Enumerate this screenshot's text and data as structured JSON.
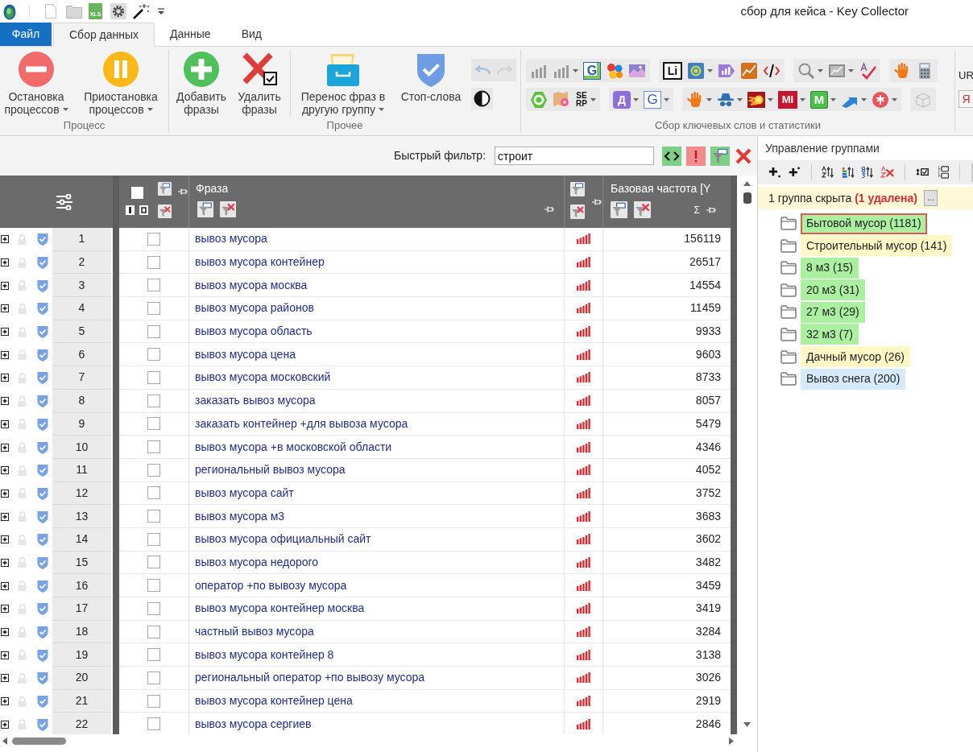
{
  "title_bar": {
    "title": "сбор для кейса - Key Collector",
    "xls_icon_text": "XLS"
  },
  "ribbon": {
    "tabs": [
      {
        "label": "Файл",
        "kind": "file",
        "selected": false
      },
      {
        "label": "Сбор данных",
        "kind": "tab",
        "selected": true
      },
      {
        "label": "Данные",
        "kind": "tab",
        "selected": false
      },
      {
        "label": "Вид",
        "kind": "tab",
        "selected": false
      }
    ],
    "groups": [
      {
        "label": "Процесс",
        "history_tools": false,
        "sections": [
          [
            {
              "kind": "stop",
              "lines": [
                "Остановка",
                "процессов"
              ],
              "dropdown": true
            },
            {
              "kind": "pause",
              "lines": [
                "Приостановка",
                "процессов"
              ],
              "dropdown": true
            }
          ]
        ]
      },
      {
        "label": "Прочее",
        "history_tools": true,
        "sections": [
          [
            {
              "kind": "add",
              "lines": [
                "Добавить",
                "фразы"
              ],
              "dropdown": false
            },
            {
              "kind": "delete",
              "lines": [
                "Удалить",
                "фразы"
              ],
              "dropdown": false
            }
          ],
          [
            {
              "kind": "move",
              "lines": [
                "Перенос фраз в",
                "другую группу"
              ],
              "dropdown": true
            },
            {
              "kind": "stop_words",
              "lines": [
                "Стоп-слова"
              ],
              "dropdown": false
            }
          ]
        ]
      }
    ],
    "keyword_tools": {
      "label": "Сбор ключевых слов и статистики",
      "rows": [
        [
          {
            "items": [
              {
                "kind": "bars",
                "dropdown": false
              },
              {
                "kind": "bars",
                "dropdown": true
              },
              {
                "kind": "g_doc",
                "text": "G",
                "dropdown": false
              },
              {
                "kind": "dots",
                "dropdown": false
              },
              {
                "kind": "landscape",
                "dropdown": false
              }
            ]
          },
          {
            "items": [
              {
                "kind": "li",
                "text": "Li",
                "dropdown": false
              },
              {
                "kind": "globe",
                "dropdown": true
              },
              {
                "kind": "chart_tile",
                "dropdown": false
              },
              {
                "kind": "line_chart_tile",
                "dropdown": false
              },
              {
                "kind": "code",
                "dropdown": false
              }
            ]
          },
          {
            "items": [
              {
                "kind": "search",
                "dropdown": true
              },
              {
                "kind": "image_chart",
                "dropdown": true
              },
              {
                "kind": "spellcheck",
                "dropdown": false
              }
            ]
          },
          {
            "items": [
              {
                "kind": "hand",
                "dropdown": false
              },
              {
                "kind": "calculator",
                "dropdown": false
              }
            ]
          }
        ],
        [
          {
            "items": [
              {
                "kind": "ring",
                "dropdown": false
              },
              {
                "kind": "map_pin",
                "dropdown": false
              },
              {
                "kind": "serp",
                "text": "SERP",
                "dropdown": true
              }
            ]
          },
          {
            "items": [
              {
                "kind": "d_logo",
                "text": "Д",
                "dropdown": true
              },
              {
                "kind": "g_logo",
                "text": "G",
                "dropdown": true
              }
            ]
          },
          {
            "items": [
              {
                "kind": "hand",
                "dropdown": true
              },
              {
                "kind": "spy",
                "dropdown": true
              },
              {
                "kind": "fireball",
                "dropdown": true
              },
              {
                "kind": "mi_logo",
                "text": "MI",
                "dropdown": true
              },
              {
                "kind": "m_logo",
                "text": "M",
                "dropdown": true
              },
              {
                "kind": "arrow",
                "dropdown": true
              },
              {
                "kind": "circle_logo",
                "dropdown": true
              }
            ]
          },
          {
            "items": [
              {
                "kind": "box",
                "dropdown": false
              }
            ]
          }
        ]
      ]
    },
    "cut_group": {
      "label": "UR",
      "icon_text": "Я"
    }
  },
  "filter": {
    "label": "Быстрый фильтр:",
    "value": "строит"
  },
  "table": {
    "select_all_checked": false,
    "columns": {
      "phrase": "Фраза",
      "frequency": "Базовая частота [Y",
      "sum_sign": "Σ"
    },
    "rows": [
      {
        "number": "1",
        "checked": false,
        "phrase": "вывоз мусора",
        "frequency": "156119"
      },
      {
        "number": "2",
        "checked": false,
        "phrase": "вывоз мусора контейнер",
        "frequency": "26517"
      },
      {
        "number": "3",
        "checked": false,
        "phrase": "вывоз мусора москва",
        "frequency": "14554"
      },
      {
        "number": "4",
        "checked": false,
        "phrase": "вывоз мусора районов",
        "frequency": "11459"
      },
      {
        "number": "5",
        "checked": false,
        "phrase": "вывоз мусора область",
        "frequency": "9933"
      },
      {
        "number": "6",
        "checked": false,
        "phrase": "вывоз мусора цена",
        "frequency": "9603"
      },
      {
        "number": "7",
        "checked": false,
        "phrase": "вывоз мусора московский",
        "frequency": "8733"
      },
      {
        "number": "8",
        "checked": false,
        "phrase": "заказать вывоз мусора",
        "frequency": "8057"
      },
      {
        "number": "9",
        "checked": false,
        "phrase": "заказать контейнер +для вывоза мусора",
        "frequency": "5479"
      },
      {
        "number": "10",
        "checked": false,
        "phrase": "вывоз мусора +в московской области",
        "frequency": "4346"
      },
      {
        "number": "11",
        "checked": false,
        "phrase": "региональный вывоз мусора",
        "frequency": "4052"
      },
      {
        "number": "12",
        "checked": false,
        "phrase": "вывоз мусора сайт",
        "frequency": "3752"
      },
      {
        "number": "13",
        "checked": false,
        "phrase": "вывоз мусора м3",
        "frequency": "3683"
      },
      {
        "number": "14",
        "checked": false,
        "phrase": "вывоз мусора официальный сайт",
        "frequency": "3602"
      },
      {
        "number": "15",
        "checked": false,
        "phrase": "вывоз мусора недорого",
        "frequency": "3482"
      },
      {
        "number": "16",
        "checked": false,
        "phrase": "оператор +по вывозу мусора",
        "frequency": "3459"
      },
      {
        "number": "17",
        "checked": false,
        "phrase": "вывоз мусора контейнер москва",
        "frequency": "3419"
      },
      {
        "number": "18",
        "checked": false,
        "phrase": "частный вывоз мусора",
        "frequency": "3284"
      },
      {
        "number": "19",
        "checked": false,
        "phrase": "вывоз мусора контейнер 8",
        "frequency": "3138"
      },
      {
        "number": "20",
        "checked": false,
        "phrase": "региональный оператор +по вывозу мусора",
        "frequency": "3026"
      },
      {
        "number": "21",
        "checked": false,
        "phrase": "вывоз мусора контейнер цена",
        "frequency": "2919"
      },
      {
        "number": "22",
        "checked": false,
        "phrase": "вывоз мусора сергиев",
        "frequency": "2846"
      }
    ]
  },
  "groups_panel": {
    "title": "Управление группами",
    "notice": "1 группа скрыта **(1 удалена)**",
    "notice_button": "...",
    "groups": [
      {
        "label": "Бытовой мусор (1181)",
        "color": "#aaf0a0",
        "selected": true
      },
      {
        "label": "Строительный мусор (141)",
        "color": "#fff7c6",
        "selected": false
      },
      {
        "label": "8 м3 (15)",
        "color": "#aaf0a0",
        "selected": false
      },
      {
        "label": "20 м3 (31)",
        "color": "#aaf0a0",
        "selected": false
      },
      {
        "label": "27 м3 (29)",
        "color": "#aaf0a0",
        "selected": false
      },
      {
        "label": "32 м3 (7)",
        "color": "#aaf0a0",
        "selected": false
      },
      {
        "label": "Дачный мусор (26)",
        "color": "#fff7c6",
        "selected": false
      },
      {
        "label": "Вывоз снега (200)",
        "color": "#d5ebf9",
        "selected": false
      }
    ]
  }
}
